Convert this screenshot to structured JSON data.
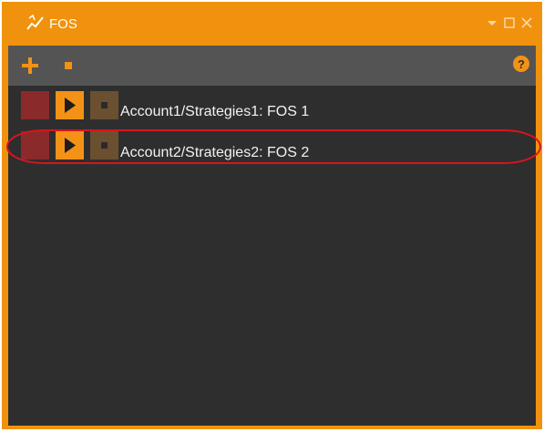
{
  "window": {
    "title": "FOS",
    "icon": "chart-trend-icon",
    "controls": [
      "dropdown-icon",
      "maximize-icon",
      "close-icon"
    ]
  },
  "toolbar": {
    "add_icon": "plus-icon",
    "stop_icon": "stop-icon",
    "help_icon": "help-icon"
  },
  "strategies": [
    {
      "label": "Account1/Strategies1: FOS 1"
    },
    {
      "label": "Account2/Strategies2: FOS 2",
      "highlighted": true
    }
  ],
  "colors": {
    "accent": "#f0920d",
    "toolbar": "#545454",
    "panel": "#2e2e2e",
    "highlight": "#d9141d"
  }
}
